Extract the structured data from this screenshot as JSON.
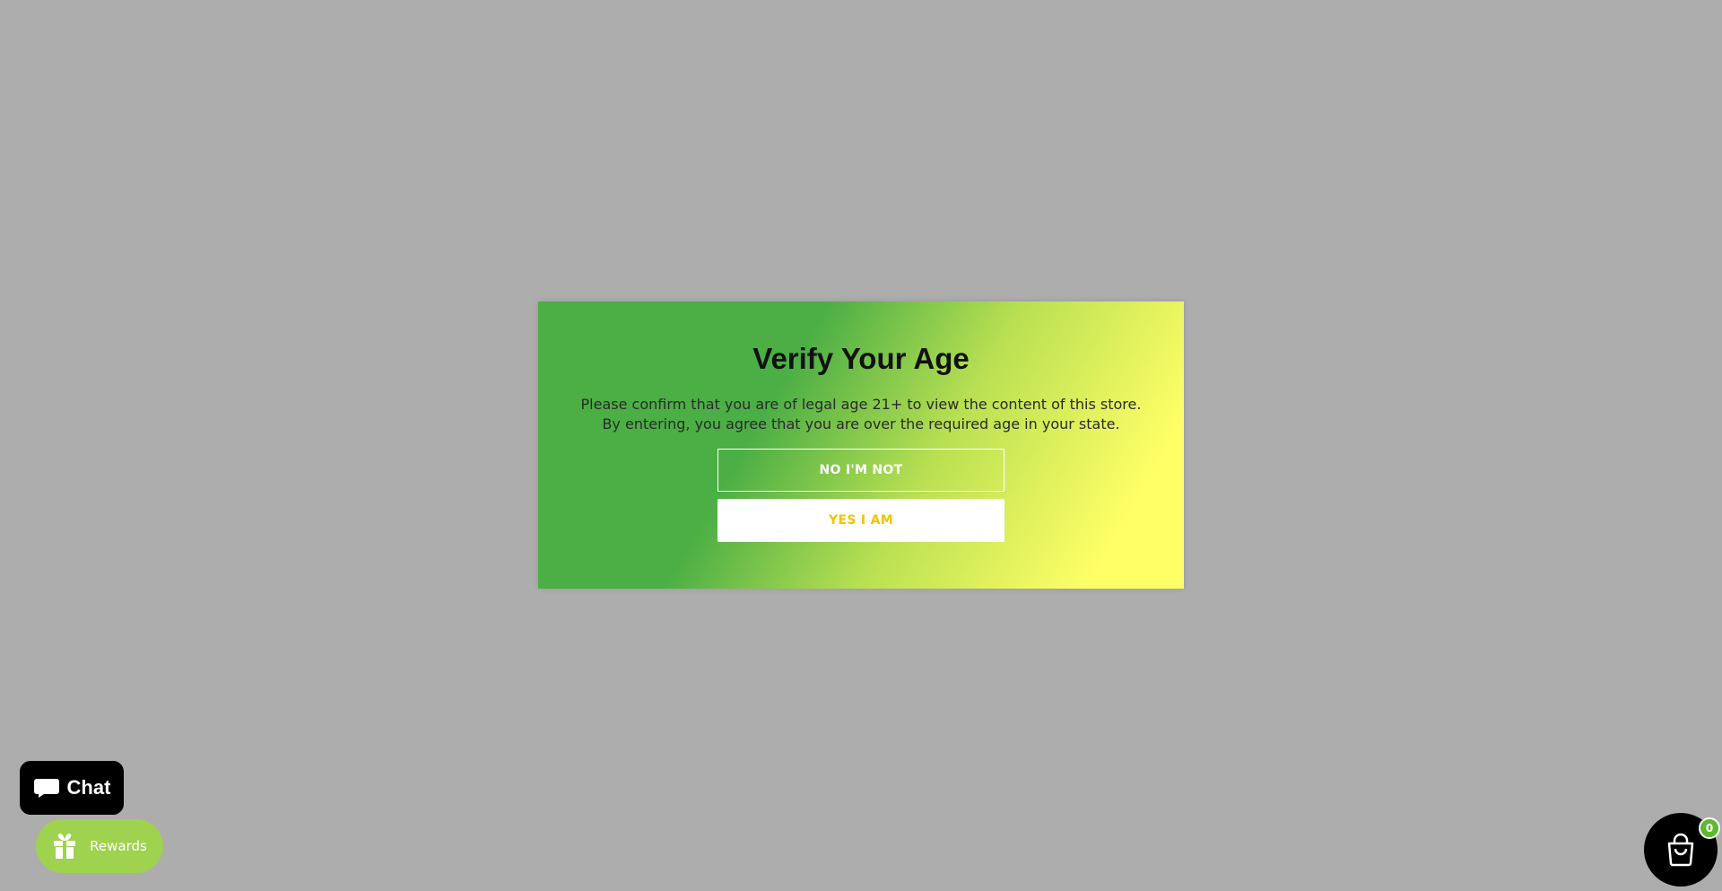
{
  "age_modal": {
    "title": "Verify Your Age",
    "message": "Please confirm that you are of legal age 21+ to view the content of this store. By entering, you agree that you are over the required age in your state.",
    "decline_label": "NO I'M NOT",
    "accept_label": "YES I AM"
  },
  "chat": {
    "label": "Chat",
    "icon": "chat-bubble-icon"
  },
  "rewards": {
    "label": "Rewards",
    "icon": "gift-icon"
  },
  "cart": {
    "icon": "shopping-bag-icon",
    "count": "0"
  },
  "colors": {
    "overlay": "#adadad",
    "gradient_start": "#4caf45",
    "gradient_end": "#ffff66",
    "accept_text": "#f2c400",
    "rewards_bg": "#9fd24e",
    "badge_bg": "#5fb832"
  }
}
